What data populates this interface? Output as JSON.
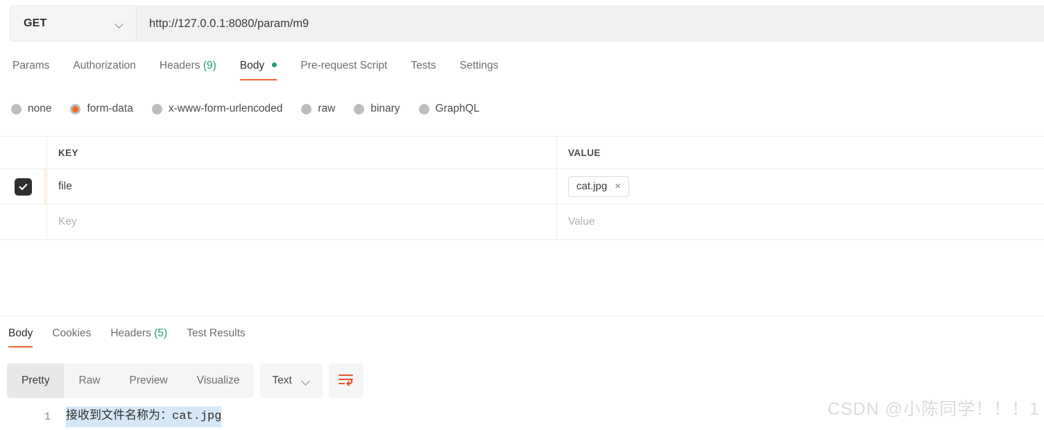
{
  "request": {
    "method": "GET",
    "url": "http://127.0.0.1:8080/param/m9",
    "tabs": [
      {
        "label": "Params",
        "count": "",
        "active": false
      },
      {
        "label": "Authorization",
        "count": "",
        "active": false
      },
      {
        "label": "Headers",
        "count": "(9)",
        "active": false
      },
      {
        "label": "Body",
        "count": "",
        "active": true
      },
      {
        "label": "Pre-request Script",
        "count": "",
        "active": false
      },
      {
        "label": "Tests",
        "count": "",
        "active": false
      },
      {
        "label": "Settings",
        "count": "",
        "active": false
      }
    ],
    "body_types": [
      {
        "label": "none",
        "selected": false
      },
      {
        "label": "form-data",
        "selected": true
      },
      {
        "label": "x-www-form-urlencoded",
        "selected": false
      },
      {
        "label": "raw",
        "selected": false
      },
      {
        "label": "binary",
        "selected": false
      },
      {
        "label": "GraphQL",
        "selected": false
      }
    ],
    "table": {
      "headers": {
        "key": "KEY",
        "value": "VALUE"
      },
      "rows": [
        {
          "checked": true,
          "key": "file",
          "value_chip": "cat.jpg",
          "chip_remove": "×"
        }
      ],
      "placeholder_row": {
        "key": "Key",
        "value": "Value"
      }
    }
  },
  "response": {
    "tabs": [
      {
        "label": "Body",
        "count": "",
        "active": true
      },
      {
        "label": "Cookies",
        "count": "",
        "active": false
      },
      {
        "label": "Headers",
        "count": "(5)",
        "active": false
      },
      {
        "label": "Test Results",
        "count": "",
        "active": false
      }
    ],
    "formats": [
      {
        "label": "Pretty",
        "active": true
      },
      {
        "label": "Raw",
        "active": false
      },
      {
        "label": "Preview",
        "active": false
      },
      {
        "label": "Visualize",
        "active": false
      }
    ],
    "language": "Text",
    "wrap_icon": "wrap-lines-icon",
    "lines": [
      {
        "number": "1",
        "text": "接收到文件名称为：",
        "selected_text": "cat.jpg"
      }
    ]
  },
  "watermark": "CSDN @小陈同学！！！1",
  "colors": {
    "accent": "#ef6333",
    "success": "#22a06b",
    "radio_selected": "#f26a21",
    "checkbox": "#2e2e2e",
    "wrap_icon": "#e8502a"
  }
}
